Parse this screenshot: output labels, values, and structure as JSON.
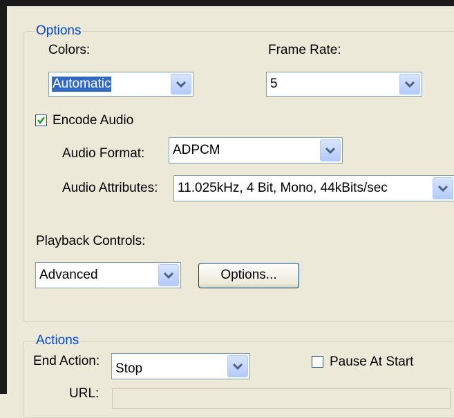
{
  "options_group": {
    "legend": "Options",
    "colors": {
      "label": "Colors:",
      "value": "Automatic"
    },
    "frame_rate": {
      "label": "Frame Rate:",
      "value": "5"
    },
    "encode_audio": {
      "label": "Encode Audio",
      "checked": true
    },
    "audio_format": {
      "label": "Audio Format:",
      "value": "ADPCM"
    },
    "audio_attributes": {
      "label": "Audio Attributes:",
      "value": "11.025kHz, 4 Bit, Mono, 44kBits/sec"
    },
    "playback_controls": {
      "label": "Playback Controls:",
      "value": "Advanced"
    },
    "options_button": {
      "label": "Options..."
    }
  },
  "actions_group": {
    "legend": "Actions",
    "end_action": {
      "label": "End Action:",
      "value": "Stop"
    },
    "pause_at_start": {
      "label": "Pause At Start",
      "checked": false
    },
    "url_label": "URL:"
  },
  "colors": {
    "legend_text": "#0046d5",
    "selection": "#316ac5",
    "dialog_bg": "#ece9d8"
  }
}
